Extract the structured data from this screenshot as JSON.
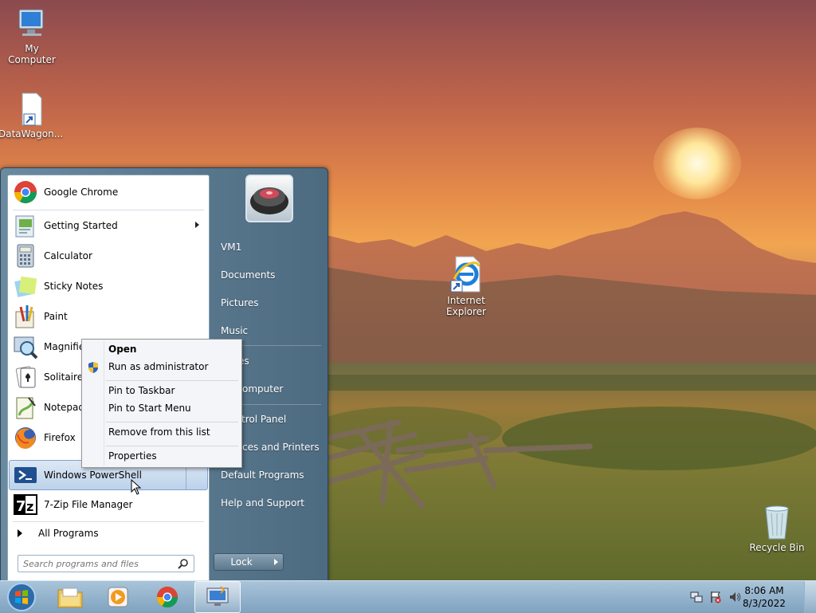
{
  "desktop": {
    "icons": [
      {
        "label": "My Computer"
      },
      {
        "label": "DataWagon..."
      },
      {
        "label_line1": "Internet",
        "label_line2": "Explorer"
      },
      {
        "label": "Recycle Bin"
      }
    ]
  },
  "start_menu": {
    "programs": [
      {
        "label": "Google Chrome",
        "icon": "chrome-icon"
      },
      {
        "label": "Getting Started",
        "icon": "getting-started-icon"
      },
      {
        "label": "Calculator",
        "icon": "calculator-icon"
      },
      {
        "label": "Sticky Notes",
        "icon": "sticky-notes-icon"
      },
      {
        "label": "Paint",
        "icon": "paint-icon"
      },
      {
        "label": "Magnifier",
        "icon": "magnifier-icon"
      },
      {
        "label": "Solitaire",
        "icon": "solitaire-icon"
      },
      {
        "label": "Notepad++",
        "icon": "notepadpp-icon"
      },
      {
        "label": "Firefox",
        "icon": "firefox-icon"
      },
      {
        "label": "Windows PowerShell",
        "icon": "powershell-icon"
      },
      {
        "label": "7-Zip File Manager",
        "icon": "7zip-icon"
      }
    ],
    "all_programs": "All Programs",
    "search_placeholder": "Search programs and files",
    "right_links": [
      {
        "label": "VM1"
      },
      {
        "label": "Documents"
      },
      {
        "label": "Pictures"
      },
      {
        "label": "Music"
      },
      {
        "label": "es"
      },
      {
        "label": "omputer"
      },
      {
        "label": "trol Panel"
      },
      {
        "label": "ces and Printers"
      },
      {
        "label": "Default Programs"
      },
      {
        "label": "Help and Support"
      }
    ],
    "lock_label": "Lock"
  },
  "context_menu": {
    "items": [
      {
        "label": "Open"
      },
      {
        "label": "Run as administrator"
      },
      {
        "label": "Pin to Taskbar"
      },
      {
        "label": "Pin to Start Menu"
      },
      {
        "label": "Remove from this list"
      },
      {
        "label": "Properties"
      }
    ]
  },
  "taskbar": {
    "clock_time": "8:06 AM",
    "clock_date": "8/3/2022"
  }
}
